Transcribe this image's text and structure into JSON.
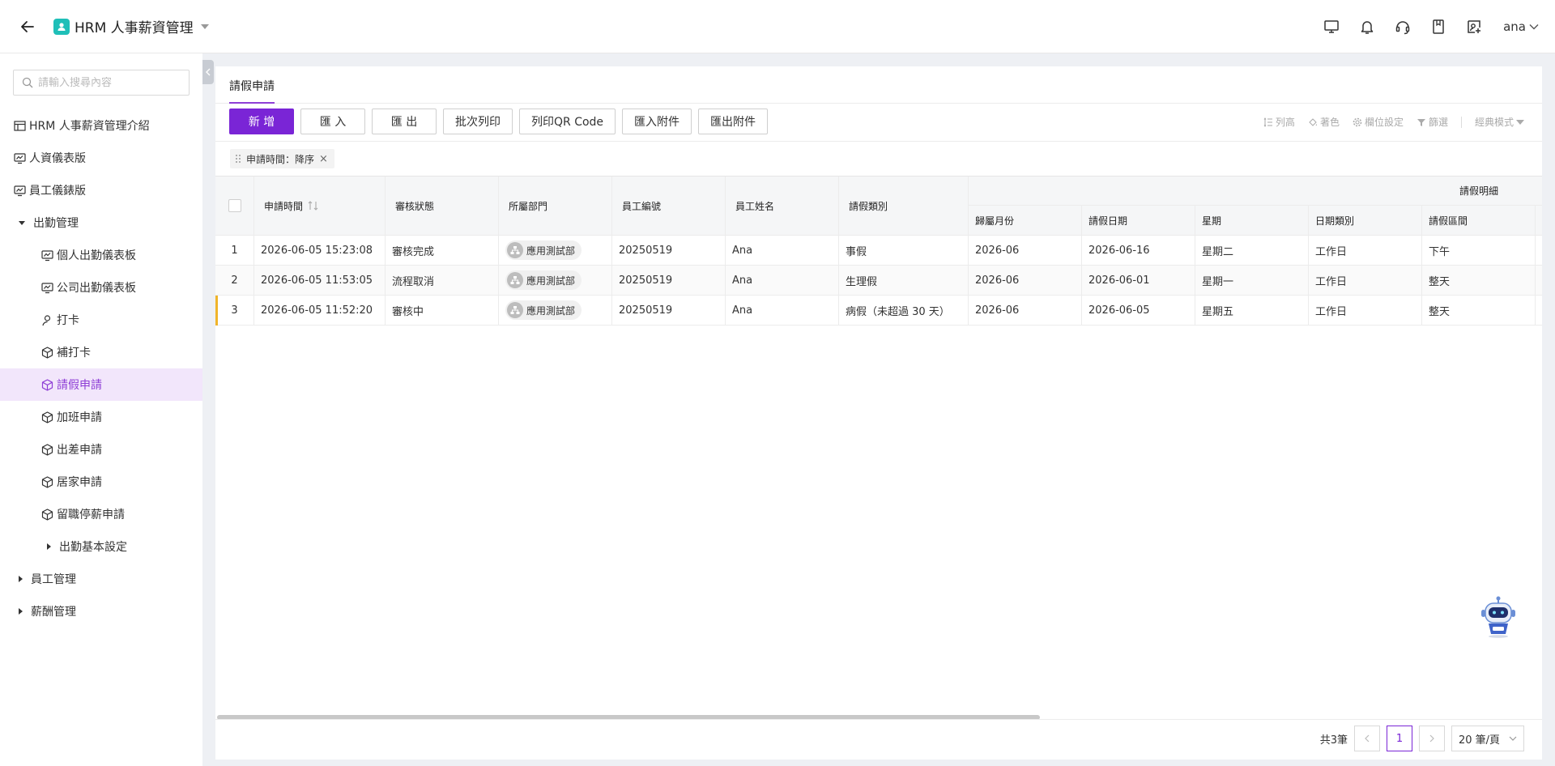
{
  "header": {
    "app_title": "HRM 人事薪資管理",
    "user_name": "ana"
  },
  "sidebar": {
    "search_placeholder": "請輸入搜尋內容",
    "items": [
      {
        "label": "HRM 人事薪資管理介紹"
      },
      {
        "label": "人資儀表版"
      },
      {
        "label": "員工儀錶版"
      },
      {
        "label": "出勤管理"
      },
      {
        "label": "個人出勤儀表板"
      },
      {
        "label": "公司出勤儀表板"
      },
      {
        "label": "打卡"
      },
      {
        "label": "補打卡"
      },
      {
        "label": "請假申請"
      },
      {
        "label": "加班申請"
      },
      {
        "label": "出差申請"
      },
      {
        "label": "居家申請"
      },
      {
        "label": "留職停薪申請"
      },
      {
        "label": "出勤基本設定"
      },
      {
        "label": "員工管理"
      },
      {
        "label": "薪酬管理"
      }
    ]
  },
  "main": {
    "tab_label": "請假申請",
    "toolbar": {
      "add": "新 增",
      "import": "匯 入",
      "export": "匯 出",
      "batch_print": "批次列印",
      "print_qr": "列印QR Code",
      "import_attach": "匯入附件",
      "export_attach": "匯出附件"
    },
    "tools": {
      "row_height": "列高",
      "color": "著色",
      "field_settings": "欄位設定",
      "filter": "篩選",
      "view_mode": "經典模式"
    },
    "sort_tag": "申請時間：降序",
    "table": {
      "group_header": "請假明細",
      "columns": {
        "apply_time": "申請時間",
        "review_status": "審核狀態",
        "department": "所屬部門",
        "emp_no": "員工編號",
        "emp_name": "員工姓名",
        "leave_type": "請假類別",
        "belong_month": "歸屬月份",
        "leave_date": "請假日期",
        "weekday": "星期",
        "day_type": "日期類別",
        "leave_period": "請假區間"
      },
      "rows": [
        {
          "no": "1",
          "apply_time": "2026-06-05 15:23:08",
          "review_status": "審核完成",
          "department": "應用測試部",
          "emp_no": "20250519",
          "emp_name": "Ana",
          "leave_type": "事假",
          "belong_month": "2026-06",
          "leave_date": "2026-06-16",
          "weekday": "星期二",
          "day_type": "工作日",
          "leave_period": "下午"
        },
        {
          "no": "2",
          "apply_time": "2026-06-05 11:53:05",
          "review_status": "流程取消",
          "department": "應用測試部",
          "emp_no": "20250519",
          "emp_name": "Ana",
          "leave_type": "生理假",
          "belong_month": "2026-06",
          "leave_date": "2026-06-01",
          "weekday": "星期一",
          "day_type": "工作日",
          "leave_period": "整天"
        },
        {
          "no": "3",
          "apply_time": "2026-06-05 11:52:20",
          "review_status": "審核中",
          "department": "應用測試部",
          "emp_no": "20250519",
          "emp_name": "Ana",
          "leave_type": "病假（未超過 30 天）",
          "belong_month": "2026-06",
          "leave_date": "2026-06-05",
          "weekday": "星期五",
          "day_type": "工作日",
          "leave_period": "整天"
        }
      ]
    },
    "pagination": {
      "total": "共3筆",
      "current_page": "1",
      "page_size": "20 筆/頁"
    }
  },
  "colors": {
    "accent": "#7a25d6",
    "active_bg": "#f2e6fb",
    "logo": "#1fbfb8",
    "row_marker": "#f0b429"
  }
}
